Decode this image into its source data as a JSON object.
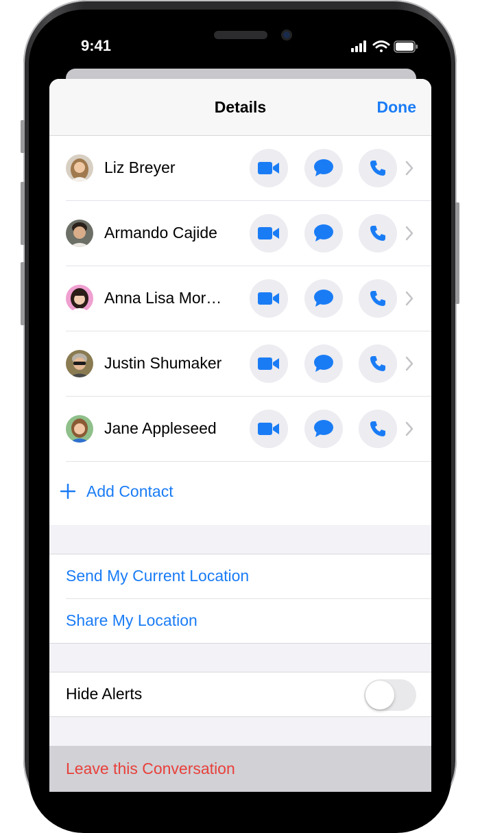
{
  "status_bar": {
    "time": "9:41",
    "icons": [
      "cellular-signal-icon",
      "wifi-icon",
      "battery-icon"
    ]
  },
  "header": {
    "title": "Details",
    "done_label": "Done"
  },
  "contacts": [
    {
      "name": "Liz Breyer"
    },
    {
      "name": "Armando Cajide"
    },
    {
      "name": "Anna Lisa Mor…"
    },
    {
      "name": "Justin Shumaker"
    },
    {
      "name": "Jane Appleseed"
    }
  ],
  "contact_actions": [
    "video-call-icon",
    "message-icon",
    "phone-icon",
    "chevron-right-icon"
  ],
  "add_contact": {
    "label": "Add Contact"
  },
  "location": {
    "send_current": "Send My Current Location",
    "share": "Share My Location"
  },
  "alerts": {
    "label": "Hide Alerts",
    "toggle_on": false
  },
  "leave": {
    "label": "Leave this Conversation"
  },
  "colors": {
    "accent": "#1a7cf5",
    "destructive": "#e8403a",
    "grouped_background": "#f2f2f7"
  }
}
